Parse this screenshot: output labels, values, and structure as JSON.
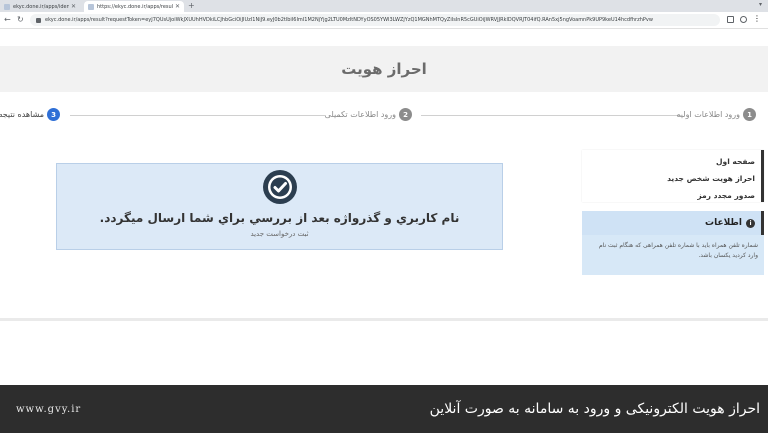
{
  "browser": {
    "tabs": [
      {
        "title": "ekyc.done.ir/apps/identi…"
      },
      {
        "title": "https://ekyc.done.ir/apps/result…"
      }
    ],
    "new_tab": "+",
    "address": "ekyc.done.ir/apps/result?requestToken=eyJ7QUsUjoiWkJXUUhHVDkiLCJhbGciOiJIUzI1NiJ9.eyJ0b2tlbiI6ImI1M2NjYjg2LTU0MzItNDYyOS05YWI3LWZjYzQ1MGNhMTQyZiIsInR5cGUiOiJWRVJJRklDQVRJT04ifQ.RAn5xj5ngVoamnPk9UP9keU14hcdfhrzhPvw"
  },
  "header": {
    "title": "احراز هویت"
  },
  "steps": [
    {
      "num": "1",
      "label": "ورود اطلاعات اولیه"
    },
    {
      "num": "2",
      "label": "ورود اطلاعات تکمیلی"
    },
    {
      "num": "3",
      "label": "مشاهده نتیجه"
    }
  ],
  "sidebar": {
    "items": [
      {
        "label": "صفحه اول"
      },
      {
        "label": "احراز هویت شخص جدید"
      },
      {
        "label": "صدور مجدد رمز"
      }
    ]
  },
  "info": {
    "title": "اطلاعات",
    "icon_char": "i",
    "body": "شماره تلفن همراه باید با شماره تلفن همراهی که هنگام ثبت نام وارد کردید یکسان باشد."
  },
  "result": {
    "message": "نام کاربري و گذرواژه بعد از بررسي براي شما ارسال ميگردد.",
    "new_request_link": "ثبت درخواست جدید"
  },
  "footer": {
    "site": "www.gvy.ir",
    "caption": "احراز هویت الکترونیکی و ورود به سامانه به صورت آنلاین"
  },
  "colors": {
    "accent": "#2f6fd6",
    "result_bg": "#dce9f7",
    "footer_bg": "#2d2d2d"
  }
}
